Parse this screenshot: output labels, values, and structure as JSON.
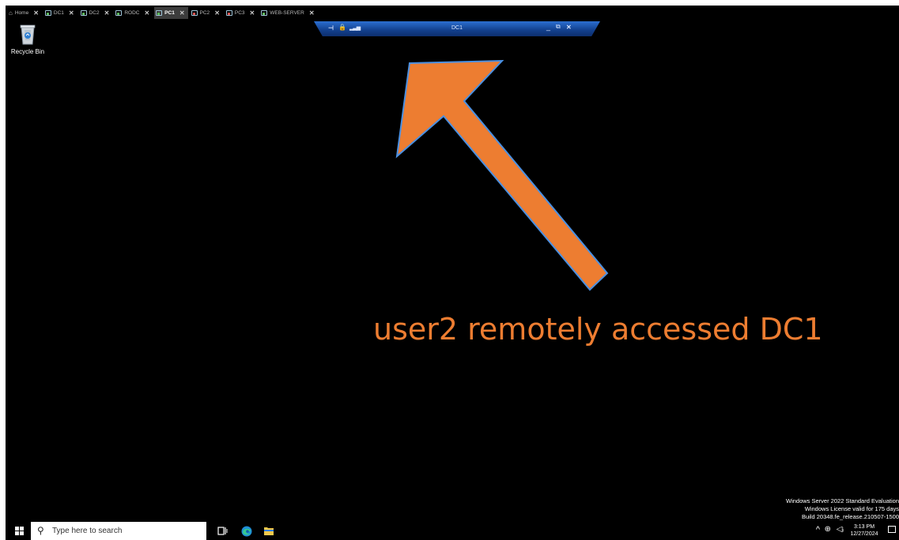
{
  "tabs": [
    {
      "label": "Home",
      "icon": "home-icon",
      "active": false
    },
    {
      "label": "DC1",
      "icon": "vm-running-icon",
      "active": false
    },
    {
      "label": "DC2",
      "icon": "vm-running-icon",
      "active": false
    },
    {
      "label": "RODC",
      "icon": "vm-running-icon",
      "active": false
    },
    {
      "label": "PC1",
      "icon": "vm-running-icon",
      "active": true
    },
    {
      "label": "PC2",
      "icon": "vm-paused-icon",
      "active": false
    },
    {
      "label": "PC3",
      "icon": "vm-paused-icon",
      "active": false
    },
    {
      "label": "WEB-SERVER",
      "icon": "vm-off-icon",
      "active": false
    }
  ],
  "tab_close_glyph": "✕",
  "remote_bar": {
    "title": "DC1",
    "pin_glyph": "⊣",
    "lock_glyph": "🔒",
    "signal_glyph": "▂▃▅",
    "minimize_glyph": "_",
    "restore_glyph": "⧉",
    "close_glyph": "✕",
    "color": "#1a4fa8"
  },
  "desktop": {
    "recycle_bin_label": "Recycle Bin"
  },
  "annotation": {
    "caption": "user2 remotely accessed DC1",
    "color": "#ed7d31",
    "outline_color": "#4a90e2"
  },
  "watermark": {
    "line1": "Windows Server 2022 Standard Evaluation",
    "line2": "Windows License valid for 175 days",
    "line3": "Build 20348.fe_release.210507-1500"
  },
  "taskbar": {
    "search_placeholder": "Type here to search",
    "clock_time": "3:13 PM",
    "clock_date": "12/27/2024",
    "chevron_glyph": "^",
    "network_glyph": "⊕",
    "volume_glyph": "◁ᵢ"
  }
}
